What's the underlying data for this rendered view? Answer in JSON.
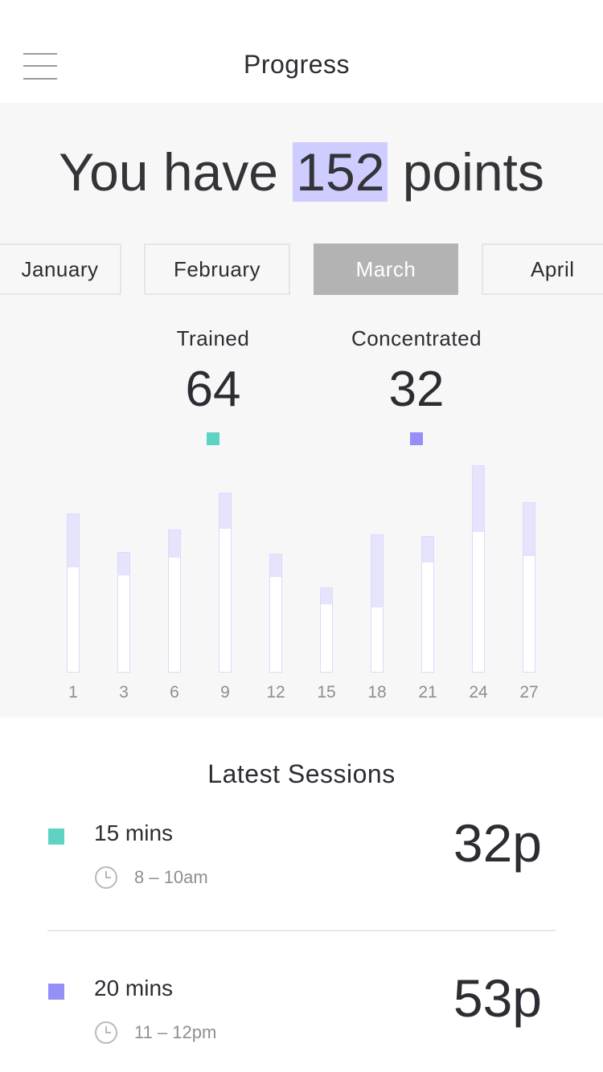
{
  "header": {
    "title": "Progress",
    "menu_icon": "hamburger-menu-icon"
  },
  "headline": {
    "prefix": "You have ",
    "points": "152",
    "suffix": " points",
    "highlight_color": "#cfccff"
  },
  "months": [
    {
      "label": "January",
      "active": false
    },
    {
      "label": "February",
      "active": false
    },
    {
      "label": "March",
      "active": true
    },
    {
      "label": "April",
      "active": false
    }
  ],
  "metrics": {
    "trained": {
      "label": "Trained",
      "value": "64",
      "color": "#5ed3c3"
    },
    "concentrated": {
      "label": "Concentrated",
      "value": "32",
      "color": "#9490f5"
    }
  },
  "chart_data": {
    "type": "bar",
    "categories": [
      "1",
      "3",
      "6",
      "9",
      "12",
      "15",
      "18",
      "21",
      "24",
      "27"
    ],
    "series": [
      {
        "values": [
          130,
          120,
          142,
          178,
          118,
          84,
          80,
          136,
          174,
          144
        ],
        "color": "#ffffff"
      },
      {
        "values": [
          66,
          28,
          34,
          44,
          28,
          20,
          90,
          32,
          82,
          66
        ],
        "color": "#e6e4fd"
      }
    ],
    "ylim": [
      0,
      260
    ]
  },
  "sessions": {
    "title": "Latest Sessions",
    "items": [
      {
        "duration": "15 mins",
        "time": "8 – 10am",
        "points": "32p",
        "color": "#5ed3c3"
      },
      {
        "duration": "20 mins",
        "time": "11 – 12pm",
        "points": "53p",
        "color": "#9490f5"
      }
    ]
  }
}
